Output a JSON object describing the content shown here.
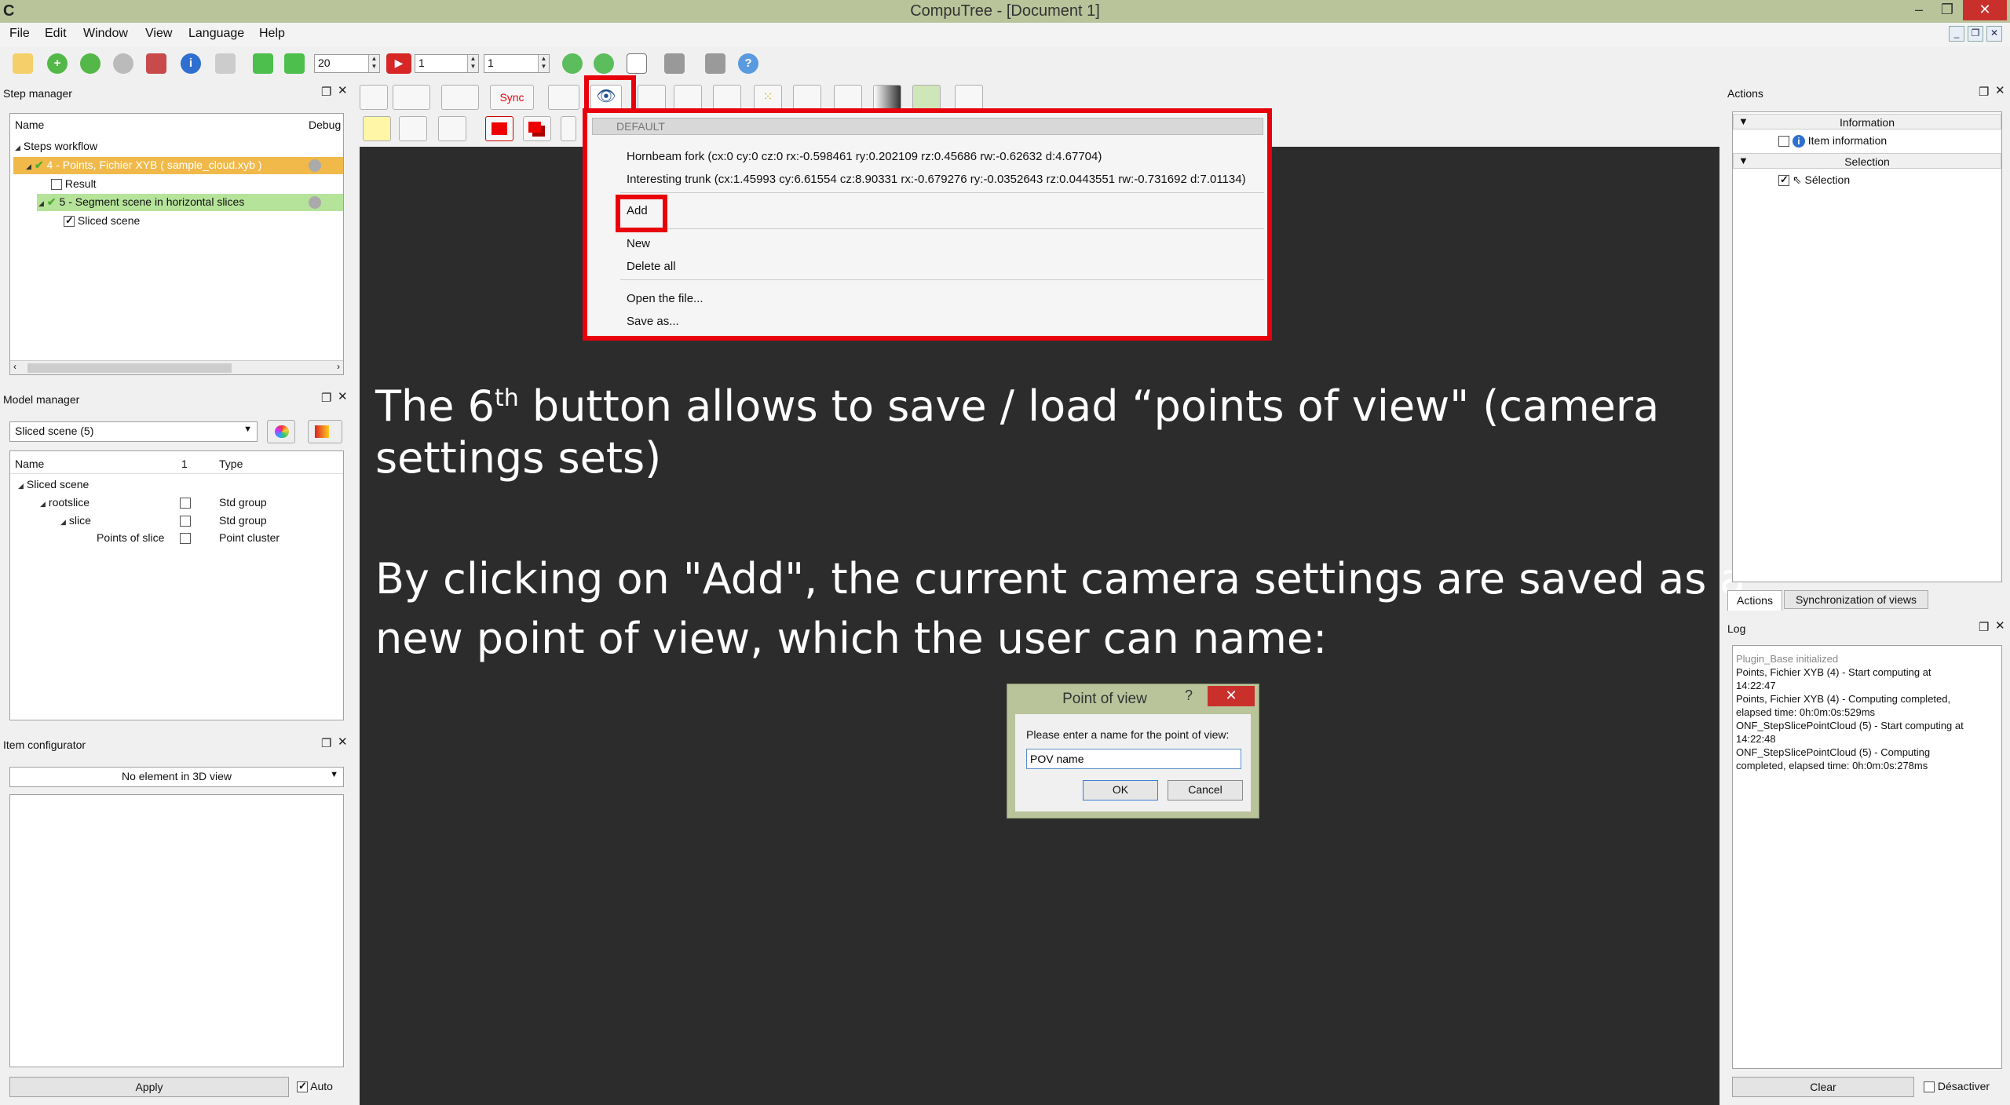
{
  "window": {
    "title": "CompuTree - [Document 1]",
    "app_icon": "C",
    "minimize": "–",
    "maximize": "❐",
    "close": "✕"
  },
  "menu": [
    "File",
    "Edit",
    "Window",
    "View",
    "Language",
    "Help"
  ],
  "toolbar": {
    "speed_value": "20",
    "frame_value": "1",
    "step_value": "1"
  },
  "step_manager": {
    "title": "Step manager",
    "col_name": "Name",
    "col_debug": "Debug",
    "items": [
      "Steps workflow",
      "4 - Points, Fichier XYB ( sample_cloud.xyb )",
      "Result",
      "5 - Segment scene in horizontal slices",
      "Sliced scene"
    ]
  },
  "model_manager": {
    "title": "Model manager",
    "selector": "Sliced scene (5)",
    "col_name": "Name",
    "col_1": "1",
    "col_type": "Type",
    "rows": [
      {
        "name": "Sliced scene",
        "type": ""
      },
      {
        "name": "rootslice",
        "type": "Std group"
      },
      {
        "name": "slice",
        "type": "Std group"
      },
      {
        "name": "Points of slice",
        "type": "Point cluster"
      }
    ]
  },
  "item_configurator": {
    "title": "Item configurator",
    "selector": "No element in 3D view",
    "apply": "Apply",
    "auto": "Auto"
  },
  "view_toolbar": {
    "sync": "Sync"
  },
  "pov_menu": {
    "header": "DEFAULT",
    "items": [
      "Hornbeam fork (cx:0 cy:0 cz:0 rx:-0.598461 ry:0.202109 rz:0.45686 rw:-0.62632 d:4.67704)",
      "Interesting trunk (cx:1.45993 cy:6.61554 cz:8.90331 rx:-0.679276 ry:-0.0352643 rz:0.0443551 rw:-0.731692 d:7.01134)"
    ],
    "add": "Add",
    "new": "New",
    "delete_all": "Delete all",
    "open_file": "Open the file...",
    "save_as": "Save as..."
  },
  "overlay": {
    "p1_a": "The 6",
    "p1_sup": "th",
    "p1_b": " button allows to save / load “points of view\" (camera",
    "p1_c": "settings sets)",
    "p2_a": "By clicking on \"Add\", the current camera settings are saved as a",
    "p2_b": "new point of view, which the user can name:"
  },
  "dialog": {
    "title": "Point of view",
    "help": "?",
    "close": "✕",
    "prompt": "Please enter a name for the point of view:",
    "value": "POV name",
    "ok": "OK",
    "cancel": "Cancel"
  },
  "actions_panel": {
    "title": "Actions",
    "group_information": "Information",
    "item_information": "Item information",
    "group_selection": "Selection",
    "item_selection": "Sélection",
    "tab_actions": "Actions",
    "tab_sync": "Synchronization of views"
  },
  "log_panel": {
    "title": "Log",
    "lines": [
      "Plugin_Base initialized",
      "Points, Fichier XYB (4) - Start computing at",
      "14:22:47",
      "Points, Fichier XYB (4) - Computing completed,",
      "elapsed time: 0h:0m:0s:529ms",
      "ONF_StepSlicePointCloud (5) - Start computing at",
      "14:22:48",
      "ONF_StepSlicePointCloud (5) - Computing",
      "completed, elapsed time: 0h:0m:0s:278ms"
    ],
    "clear": "Clear",
    "disable": "Désactiver"
  },
  "colors": {
    "titlebar": "#b9c49b",
    "highlight": "#e8000b",
    "view_bg": "#2c2c2c",
    "step_done": "#f0b94a",
    "step_ok": "#b6e39a"
  }
}
